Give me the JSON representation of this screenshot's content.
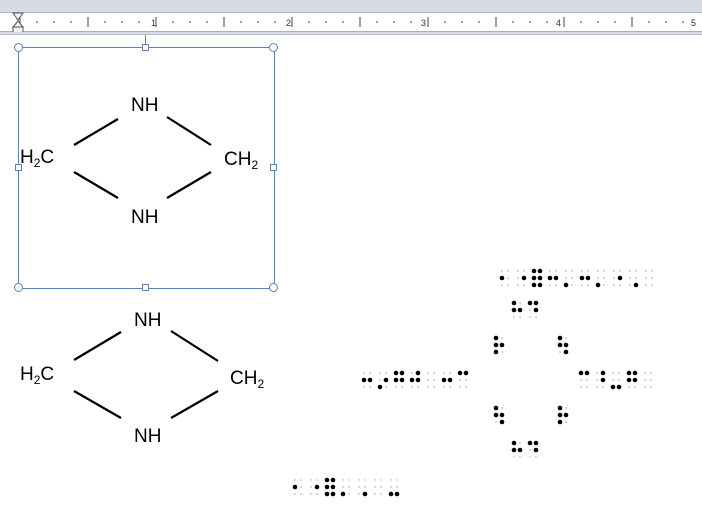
{
  "ruler": {
    "numbers": [
      "1",
      "2",
      "3",
      "4",
      "5"
    ]
  },
  "molecule_selected": {
    "top_atom": "NH",
    "bottom_atom": "NH",
    "left_atom_main": "H",
    "left_atom_sub": "2",
    "left_atom_tail": "C",
    "right_atom_main": "CH",
    "right_atom_sub": "2"
  },
  "molecule_copy": {
    "top_atom": "NH",
    "bottom_atom": "NH",
    "left_atom_main": "H",
    "left_atom_sub": "2",
    "left_atom_tail": "C",
    "right_atom_main": "CH",
    "right_atom_sub": "2"
  },
  "braille": {
    "style": "six-dot cells, raised dots black, unused positions faint grey"
  }
}
